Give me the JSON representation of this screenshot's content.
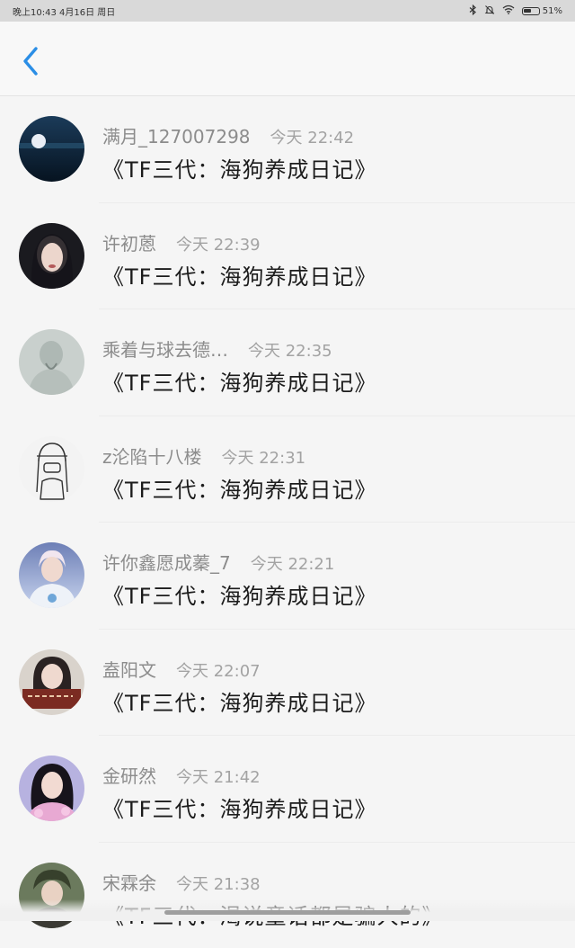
{
  "status_bar": {
    "left_text": "晚上10:43 4月16日 周日",
    "battery": "51%",
    "icons": [
      "bluetooth-icon",
      "mute-bell-icon",
      "wifi-icon",
      "battery-icon"
    ]
  },
  "nav": {
    "back_icon": "chevron-left-icon",
    "accent": "#2b8ee6"
  },
  "list": [
    {
      "name": "满月_127007298",
      "time": "今天 22:42",
      "title": "《TF三代：海狗养成日记》"
    },
    {
      "name": "许初蒽",
      "time": "今天 22:39",
      "title": "《TF三代：海狗养成日记》"
    },
    {
      "name": "乘着与球去德…",
      "time": "今天 22:35",
      "title": "《TF三代：海狗养成日记》"
    },
    {
      "name": "z沦陷十八楼",
      "time": "今天 22:31",
      "title": "《TF三代：海狗养成日记》"
    },
    {
      "name": "许你鑫愿成蓁_7",
      "time": "今天 22:21",
      "title": "《TF三代：海狗养成日记》"
    },
    {
      "name": "盍阳文",
      "time": "今天 22:07",
      "title": "《TF三代：海狗养成日记》"
    },
    {
      "name": "金研然",
      "time": "今天 21:42",
      "title": "《TF三代：海狗养成日记》"
    },
    {
      "name": "宋霖余",
      "time": "今天 21:38",
      "title": "《TF三代：渴说童话都是骗人的》"
    }
  ]
}
